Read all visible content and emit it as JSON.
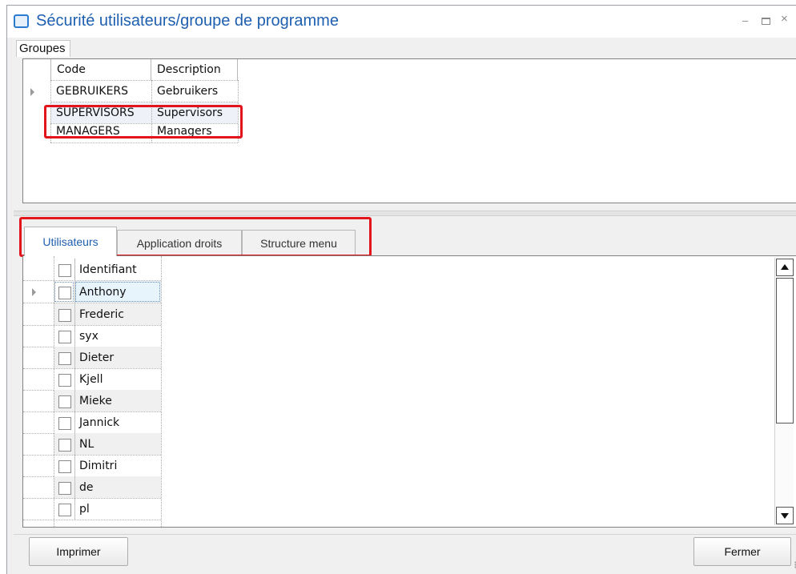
{
  "window": {
    "title": "Sécurité utilisateurs/groupe de programme",
    "controls": {
      "minimize": "–",
      "close": "×"
    }
  },
  "groups": {
    "section_label": "Groupes",
    "columns": [
      "Code",
      "Description"
    ],
    "rows": [
      {
        "code": "GEBRUIKERS",
        "description": "Gebruikers"
      },
      {
        "code": "SUPERVISORS",
        "description": "Supervisors"
      },
      {
        "code": "MANAGERS",
        "description": "Managers"
      }
    ],
    "highlighted_row": "SUPERVISORS"
  },
  "tabs": [
    {
      "label": "Utilisateurs",
      "active": true
    },
    {
      "label": "Application droits",
      "active": false
    },
    {
      "label": "Structure menu",
      "active": false
    }
  ],
  "users": {
    "header": "Identifiant",
    "rows": [
      "Anthony",
      "Frederic",
      "syx",
      "Dieter",
      "Kjell",
      "Mieke",
      "Jannick",
      "NL",
      "Dimitri",
      "de",
      "pl"
    ]
  },
  "buttons": {
    "print": "Imprimer",
    "close": "Fermer"
  },
  "colors": {
    "title": "#1e5fb0",
    "highlight": "#e3141c",
    "active_tab": "#1e5fb0"
  }
}
